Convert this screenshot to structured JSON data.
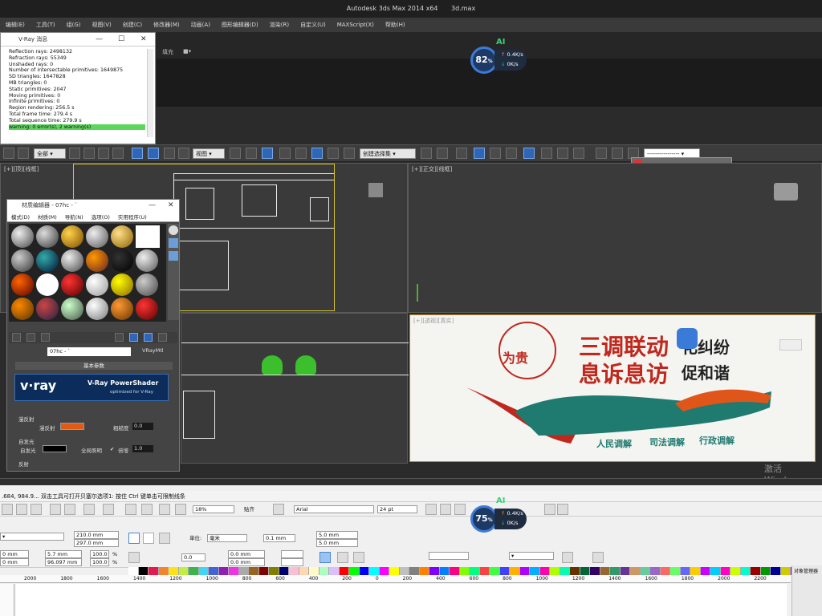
{
  "max": {
    "title": "Autodesk 3ds Max  2014 x64",
    "file": "3d.max",
    "menu": [
      "编辑(E)",
      "工具(T)",
      "组(G)",
      "视图(V)",
      "创建(C)",
      "修改器(M)",
      "动画(A)",
      "图形编辑器(D)",
      "渲染(R)",
      "自定义(U)",
      "MAXScript(X)",
      "帮助(H)"
    ],
    "ribbon_tabs": [
      "填充"
    ],
    "select_filter": "全部",
    "view_dropdown": "视图",
    "named_set": "创建选择集",
    "viewports": {
      "top_left": "[+][顶][线框]",
      "top_right": "[+][正交][线框]",
      "bottom_right": "[+][透视][真实]"
    },
    "watermark_text": "激活 Windows"
  },
  "vray_messages": {
    "title": "V-Ray 消息",
    "lines": [
      "Reflection rays: 2498132",
      "Refraction rays: 55349",
      "Unshaded rays: 0",
      "Number of intersectable primitives: 1649875",
      "  SD triangles: 1647828",
      "  MB triangles: 0",
      "  Static primitives: 2047",
      "  Moving primitives: 0",
      "  Infinite primitives: 0",
      "Region rendering: 256.5 s",
      "Total frame time: 279.4 s",
      "Total sequence time: 279.9 s"
    ],
    "warning": "warning: 0 error(s), 2 warning(s)"
  },
  "material_editor": {
    "title": "材质编辑器 - 07hc - `",
    "menu": [
      "模式(D)",
      "材质(M)",
      "导航(N)",
      "选项(O)",
      "实用程序(U)"
    ],
    "material_name": "07hc - `",
    "material_type": "VRayMtl",
    "rollout": "基本参数",
    "banner_logo": "v·ray",
    "banner_title": "V-Ray PowerShader",
    "banner_sub": "optimized for V-Ray",
    "diffuse_section": "漫反射",
    "diffuse_label": "漫反射",
    "roughness_label": "粗糙度",
    "roughness_value": "0.0",
    "self_illum_section": "自发光",
    "self_illum_label": "自发光",
    "gi_label": "全局照明",
    "multiplier_label": "倍增",
    "multiplier_value": "1.0",
    "reflect_section": "反射",
    "diffuse_color": "#e05a14"
  },
  "render_image": {
    "line1": "三调联动",
    "line2": "息诉息访",
    "right1": "化纠纷",
    "right2": "促和谐",
    "logo_text": "为贵",
    "tags": [
      "人民调解",
      "司法调解",
      "行政调解"
    ],
    "colors": {
      "red": "#c0281d",
      "teal": "#1f7a70",
      "orange": "#e0561a"
    }
  },
  "net_widgets": [
    {
      "percent": "82",
      "up": "0.4K/s",
      "down": "0K/s",
      "label": "AI"
    },
    {
      "percent": "75",
      "up": "0.4K/s",
      "down": "0K/s",
      "label": "AI"
    }
  ],
  "corel": {
    "status": ".684, 984.9... 双击工具可打开贝塞尔选项1: 按住 Ctrl 键单击可限制线条",
    "zoom": "18%",
    "snap": "贴齐",
    "font": "Arial",
    "font_size": "24 pt",
    "width": "210.0 mm",
    "height": "297.0 mm",
    "units_label": "单位:",
    "units": "毫米",
    "nudge": "0.1 mm",
    "dup_x": "5.0 mm",
    "dup_y": "5.0 mm",
    "pos_x": "0 mm",
    "pos_y": "0 mm",
    "size_w": "5.7 mm",
    "size_h": "96.097 mm",
    "scale_w": "100.0",
    "scale_h": "100.0",
    "pct": "%",
    "angle": "0.0",
    "skew1": "0.0 mm",
    "skew2": "0.0 mm",
    "ruler_ticks": [
      "2000",
      "1800",
      "1600",
      "1400",
      "1200",
      "1000",
      "800",
      "600",
      "400",
      "200",
      "0",
      "200",
      "400",
      "600",
      "800",
      "1000",
      "1200",
      "1400",
      "1600",
      "1800",
      "2000",
      "2200"
    ],
    "right_panel": "对象管理器",
    "palette": [
      "#ffffff",
      "#000000",
      "#e6194b",
      "#f58231",
      "#ffe119",
      "#bfef45",
      "#3cb44b",
      "#42d4f4",
      "#4363d8",
      "#911eb4",
      "#f032e6",
      "#a9a9a9",
      "#9a6324",
      "#800000",
      "#808000",
      "#000075",
      "#fabed4",
      "#ffd8b1",
      "#fffac8",
      "#aaffc3",
      "#dcbeff",
      "#ff0000",
      "#00ff00",
      "#0000ff",
      "#00ffff",
      "#ff00ff",
      "#ffff00",
      "#c0c0c0",
      "#808080",
      "#ff8000",
      "#8000ff",
      "#0080ff",
      "#ff0080",
      "#80ff00",
      "#00ff80",
      "#ff4040",
      "#40ff40",
      "#4040ff",
      "#ffb000",
      "#b000ff",
      "#00b0ff",
      "#ff00b0",
      "#b0ff00",
      "#00ffb0",
      "#663300",
      "#006633",
      "#330066",
      "#996633",
      "#339966",
      "#663399",
      "#cc9966",
      "#66cc99",
      "#9966cc",
      "#ff6666",
      "#66ff66",
      "#6666ff",
      "#ffcc00",
      "#cc00ff",
      "#00ccff",
      "#ff00cc",
      "#ccff00",
      "#00ffcc",
      "#990000",
      "#009900",
      "#000099",
      "#cccc00",
      "#cc00cc",
      "#00cccc"
    ]
  }
}
